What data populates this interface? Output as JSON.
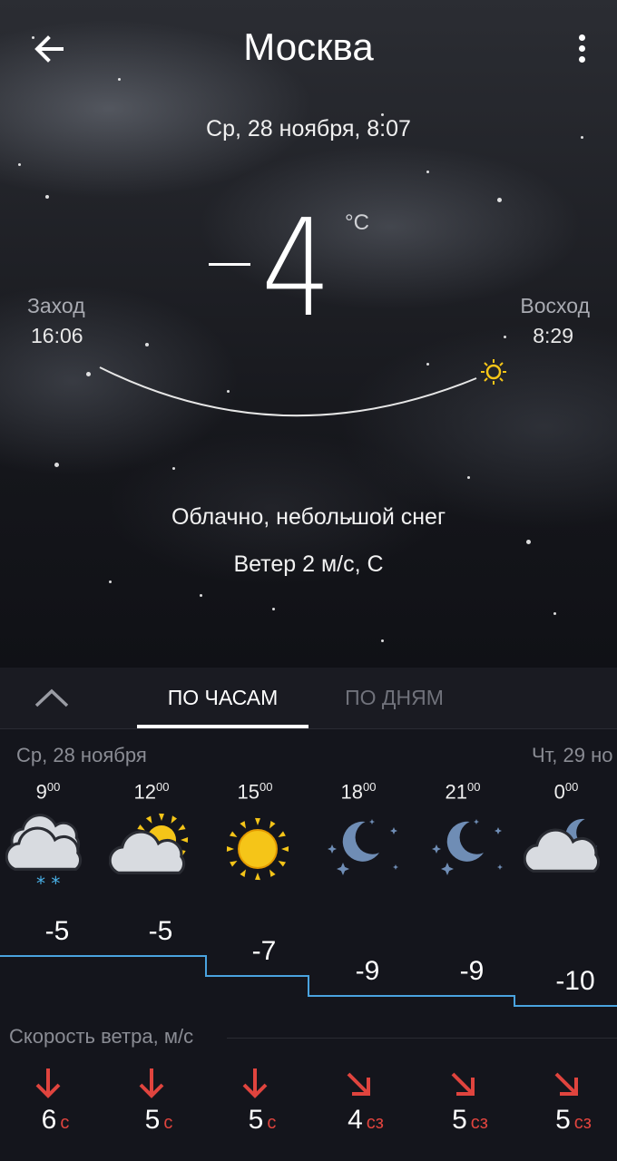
{
  "header": {
    "title": "Москва"
  },
  "current": {
    "datetime": "Ср, 28 ноября, 8:07",
    "temperature": "4",
    "temperature_sign": "−",
    "unit": "°C",
    "sunset_label": "Заход",
    "sunset_time": "16:06",
    "sunrise_label": "Восход",
    "sunrise_time": "8:29",
    "condition": "Облачно, небольшой снег",
    "wind": "Ветер 2 м/с, С"
  },
  "tabs": {
    "hourly": "ПО ЧАСАМ",
    "daily": "ПО ДНЯМ",
    "active": "hourly"
  },
  "forecast": {
    "day_left": "Ср, 28 ноября",
    "day_right": "Чт, 29 но",
    "hours": [
      {
        "hour": "9",
        "min": "00",
        "icon": "cloud-snow-icon",
        "temp": "-5"
      },
      {
        "hour": "12",
        "min": "00",
        "icon": "sun-cloud-icon",
        "temp": "-5"
      },
      {
        "hour": "15",
        "min": "00",
        "icon": "sun-icon",
        "temp": "-7"
      },
      {
        "hour": "18",
        "min": "00",
        "icon": "moon-stars-icon",
        "temp": "-9"
      },
      {
        "hour": "21",
        "min": "00",
        "icon": "moon-stars-icon",
        "temp": "-9"
      },
      {
        "hour": "0",
        "min": "00",
        "icon": "moon-cloud-icon",
        "temp": "-10"
      }
    ],
    "wind_title": "Скорость ветра, м/с",
    "wind": [
      {
        "speed": "6",
        "dir": "с",
        "arrow": "down"
      },
      {
        "speed": "5",
        "dir": "с",
        "arrow": "down"
      },
      {
        "speed": "5",
        "dir": "с",
        "arrow": "down"
      },
      {
        "speed": "4",
        "dir": "сз",
        "arrow": "down-right"
      },
      {
        "speed": "5",
        "dir": "сз",
        "arrow": "down-right"
      },
      {
        "speed": "5",
        "dir": "сз",
        "arrow": "down-right"
      }
    ]
  },
  "colors": {
    "accent_line": "#4aa3df",
    "wind_arrow": "#e0443e",
    "sun": "#f5c518",
    "moon": "#6f8db5"
  }
}
